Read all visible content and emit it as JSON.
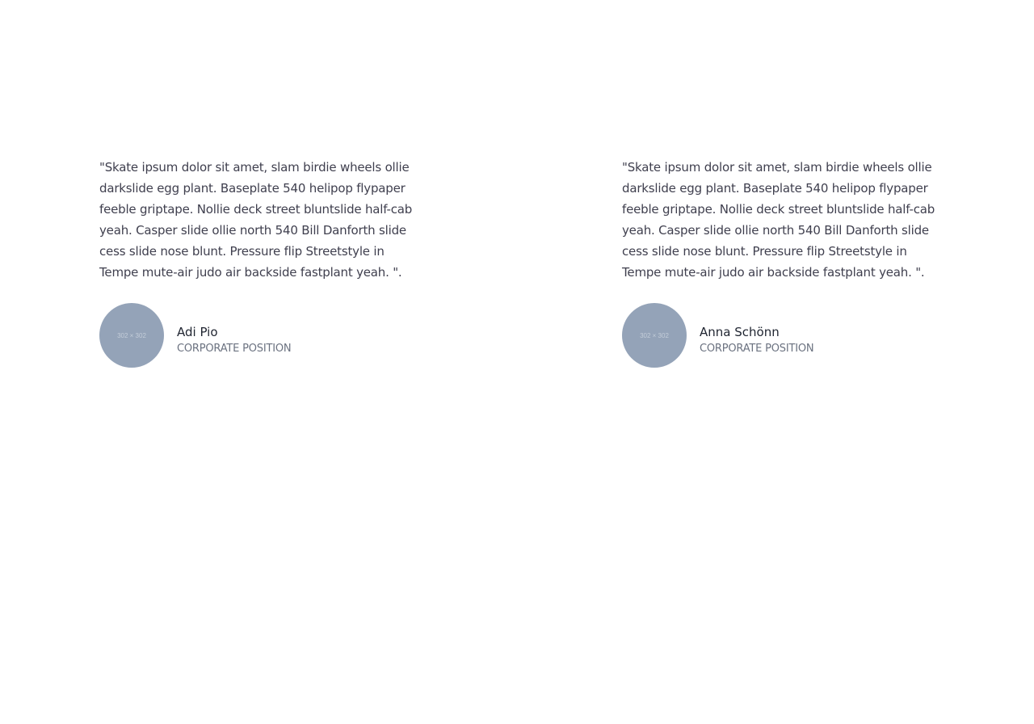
{
  "testimonials": [
    {
      "quote": "\"Skate ipsum dolor sit amet, slam birdie wheels ollie darkslide egg plant. Baseplate 540 helipop flypaper feeble griptape. Nollie deck street bluntslide half-cab yeah. Casper slide ollie north 540 Bill Danforth slide cess slide nose blunt. Pressure flip Streetstyle in Tempe mute-air judo air backside fastplant yeah. \".",
      "avatar_placeholder": "302 × 302",
      "name": "Adi Pio",
      "position": "CORPORATE POSITION"
    },
    {
      "quote": "\"Skate ipsum dolor sit amet, slam birdie wheels ollie darkslide egg plant. Baseplate 540 helipop flypaper feeble griptape. Nollie deck street bluntslide half-cab yeah. Casper slide ollie north 540 Bill Danforth slide cess slide nose blunt. Pressure flip Streetstyle in Tempe mute-air judo air backside fastplant yeah. \".",
      "avatar_placeholder": "302 × 302",
      "name": "Anna Schönn",
      "position": "CORPORATE POSITION"
    }
  ],
  "colors": {
    "text": "#3f3f4e",
    "name": "#1f2430",
    "position": "#6b7280",
    "avatar": "#94a3b8"
  }
}
